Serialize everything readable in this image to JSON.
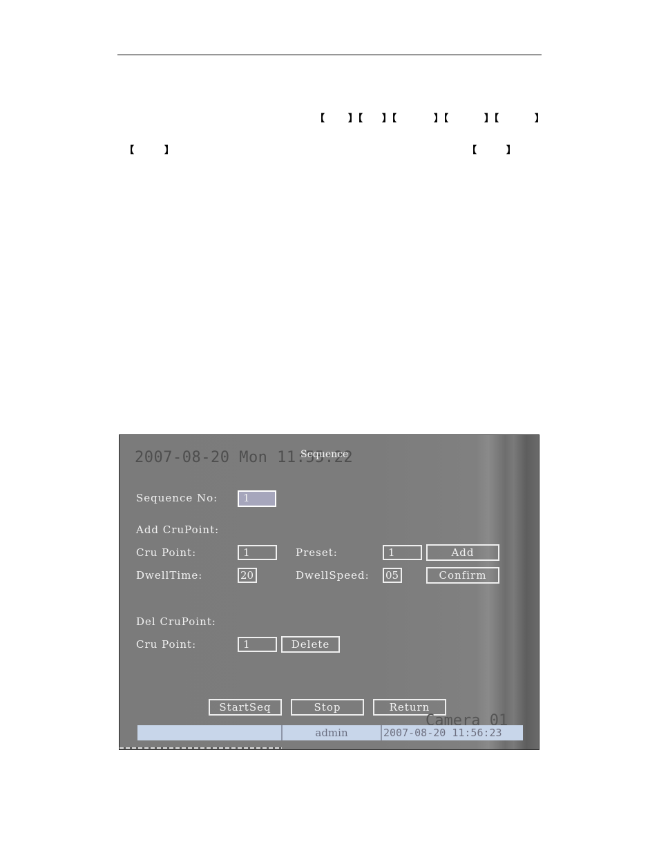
{
  "document": {
    "bracket_marks_line1": [
      "【",
      "】【",
      "】【",
      "】【",
      "】【",
      "】"
    ],
    "bracket_marks_line2_left": [
      "【",
      "】"
    ],
    "bracket_marks_line2_right": [
      "【",
      "】"
    ]
  },
  "screen": {
    "osd_datetime": "2007-08-20 Mon 11:55:22",
    "dialog_title": "Sequence",
    "sequence_no_label": "Sequence No:",
    "sequence_no_value": "1",
    "add_section_label": "Add CruPoint:",
    "add_cru_point_label": "Cru Point:",
    "add_cru_point_value": "1",
    "preset_label": "Preset:",
    "preset_value": "1",
    "add_button": "Add",
    "dwell_time_label": "DwellTime:",
    "dwell_time_value": "20",
    "dwell_speed_label": "DwellSpeed:",
    "dwell_speed_value": "05",
    "confirm_button": "Confirm",
    "del_section_label": "Del CruPoint:",
    "del_cru_point_label": "Cru Point:",
    "del_cru_point_value": "1",
    "delete_button": "Delete",
    "start_button": "StartSeq",
    "stop_button": "Stop",
    "return_button": "Return",
    "camera_label": "Camera 01",
    "status_bar": {
      "cell1": "",
      "user": "admin",
      "datetime": "2007-08-20 11:56:23"
    }
  }
}
